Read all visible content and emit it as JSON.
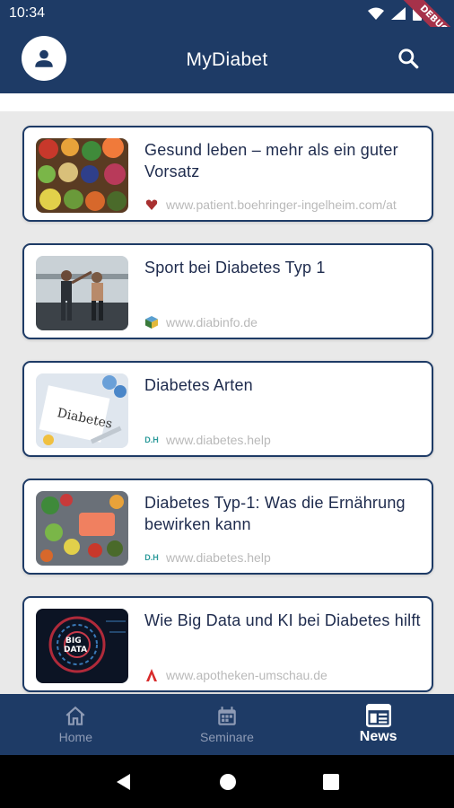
{
  "status_bar": {
    "time": "10:34",
    "debug_label": "DEBUG"
  },
  "app_bar": {
    "title": "MyDiabet",
    "avatar_icon": "account-icon",
    "search_icon": "search-icon"
  },
  "colors": {
    "primary": "#1e3b66",
    "card_border": "#1e3b66",
    "background": "#e9e9e9",
    "source_text": "#b9b9b9"
  },
  "news": [
    {
      "title": "Gesund leben – mehr als ein guter Vorsatz",
      "source": "www.patient.boehringer-ingelheim.com/at",
      "source_icon": "heart-logo-icon"
    },
    {
      "title": "Sport bei Diabetes Typ 1",
      "source": "www.diabinfo.de",
      "source_icon": "cube-logo-icon"
    },
    {
      "title": "Diabetes Arten",
      "source": "www.diabetes.help",
      "source_icon": "dh-logo-icon",
      "source_badge": "D.H"
    },
    {
      "title": "Diabetes Typ-1: Was die Ernährung bewirken kann",
      "source": "www.diabetes.help",
      "source_icon": "dh-logo-icon",
      "source_badge": "D.H"
    },
    {
      "title": "Wie Big Data und KI bei Diabetes hilft",
      "source": "www.apotheken-umschau.de",
      "source_icon": "apotheke-logo-icon"
    }
  ],
  "bottom_nav": [
    {
      "label": "Home",
      "icon": "home-icon",
      "active": false
    },
    {
      "label": "Seminare",
      "icon": "calendar-icon",
      "active": false
    },
    {
      "label": "News",
      "icon": "news-icon",
      "active": true
    }
  ],
  "system_nav": {
    "back": "back-icon",
    "home": "home-circle-icon",
    "recents": "recents-icon"
  }
}
